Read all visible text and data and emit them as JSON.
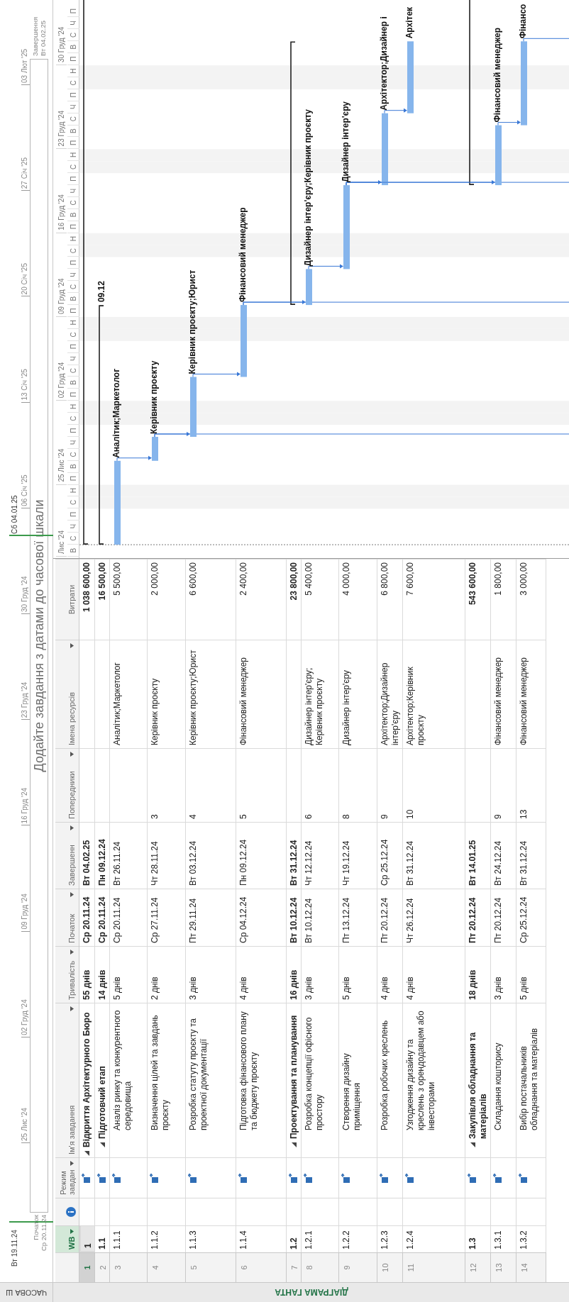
{
  "side_labels": {
    "timeline": "ЧАСОВА Ш",
    "gantt": "ДІАГРАМА ГАНТА"
  },
  "timeline": {
    "range_start": "Вт 19.11.24",
    "current_date": "Сб 04.01.25",
    "start_label": "Початок",
    "start_date": "Ср 20.11.24",
    "finish_label": "Завершення",
    "finish_date": "Вт 04.02.25",
    "hint": "Додайте завдання з датами до часової шкали",
    "ticks": [
      "25 Лис '24",
      "02 Груд '24",
      "09 Груд '24",
      "16 Груд '24",
      "23 Груд '24",
      "30 Груд '24",
      "06 Січ '25",
      "13 Січ '25",
      "20 Січ '25",
      "27 Січ '25",
      "03 Лют '25"
    ]
  },
  "table": {
    "columns": [
      {
        "kind": "text",
        "label": "WB",
        "dropdown": true,
        "selected": true
      },
      {
        "kind": "info",
        "selected": false
      },
      {
        "kind": "text",
        "label": "Режим завдан",
        "dropdown": true,
        "selected": false
      },
      {
        "kind": "text",
        "label": "Ім'я завдання",
        "dropdown": true,
        "selected": false
      },
      {
        "kind": "text",
        "label": "Тривалість",
        "dropdown": true,
        "selected": false
      },
      {
        "kind": "text",
        "label": "Початок",
        "dropdown": true,
        "selected": false
      },
      {
        "kind": "text",
        "label": "Завершенн",
        "dropdown": true,
        "selected": false
      },
      {
        "kind": "text",
        "label": "Попередники",
        "dropdown": true,
        "selected": false
      },
      {
        "kind": "text",
        "label": "Імена ресурсів",
        "dropdown": true,
        "selected": false
      },
      {
        "kind": "text",
        "label": "Витрати",
        "dropdown": false,
        "selected": false
      }
    ],
    "rows": [
      {
        "row": "1",
        "wbs": "1",
        "name": "Відкриття Архітектурного Бюро",
        "duration": "55 днів",
        "start": "Ср 20.11.24",
        "finish": "Вт 04.02.25",
        "cost": "1 038 600,00",
        "selected": true,
        "expanded": true,
        "children": [
          {
            "row": "2",
            "wbs": "1.1",
            "name": "Підготовчий етап",
            "duration": "14 днів",
            "start": "Ср 20.11.24",
            "finish": "Пн 09.12.24",
            "cost": "16 500,00",
            "selected": false,
            "expanded": true,
            "bar_label": "09.12",
            "children": [
              {
                "row": "3",
                "wbs": "1.1.1",
                "name": "Аналіз ринку та конкурентного середовища",
                "duration": "5 днів",
                "start": "Ср 20.11.24",
                "finish": "Вт 26.11.24",
                "resources": "Аналітик;Маркетолог",
                "cost": "5 500,00",
                "selected": false,
                "bar_label": "Аналітик;Маркетолог"
              },
              {
                "row": "4",
                "wbs": "1.1.2",
                "name": "Визначення цілей та завдань проєкту",
                "duration": "2 днів",
                "start": "Ср 27.11.24",
                "finish": "Чт 28.11.24",
                "predecessors": "3",
                "resources": "Керівник проєкту",
                "cost": "2 000,00",
                "selected": false,
                "bar_label": "Керівник проєкту",
                "link_below": true
              },
              {
                "row": "5",
                "wbs": "1.1.3",
                "name": "Розробка статуту проєкту та проектної документації",
                "duration": "3 днів",
                "start": "Пт 29.11.24",
                "finish": "Вт 03.12.24",
                "predecessors": "4",
                "resources": "Керівник проєкту;Юрист",
                "cost": "6 600,00",
                "selected": false,
                "bar_label": "Керівник проєкту;Юрист"
              },
              {
                "row": "6",
                "wbs": "1.1.4",
                "name": "Підготовка фінансового плану та бюджету проєкту",
                "duration": "4 днів",
                "start": "Ср 04.12.24",
                "finish": "Пн 09.12.24",
                "predecessors": "5",
                "resources": "Фінансовий менеджер",
                "cost": "2 400,00",
                "selected": false,
                "bar_label": "Фінансовий менеджер",
                "link_below": true
              }
            ]
          },
          {
            "row": "7",
            "wbs": "1.2",
            "name": "Проектування та планування",
            "duration": "16 днів",
            "start": "Вт 10.12.24",
            "finish": "Вт 31.12.24",
            "cost": "23 800,00",
            "selected": false,
            "expanded": true,
            "children": [
              {
                "row": "8",
                "wbs": "1.2.1",
                "name": "Розробка концепції офісного простору",
                "duration": "3 днів",
                "start": "Вт 10.12.24",
                "finish": "Чт 12.12.24",
                "predecessors": "6",
                "resources": "Дизайнер інтер'єру;Керівник проєкту",
                "cost": "5 400,00",
                "selected": false,
                "bar_label": "Дизайнер інтер'єру;Керівник проєкту"
              },
              {
                "row": "9",
                "wbs": "1.2.2",
                "name": "Створення дизайну приміщення",
                "duration": "5 днів",
                "start": "Пт 13.12.24",
                "finish": "Чт 19.12.24",
                "predecessors": "8",
                "resources": "Дизайнер інтер'єру",
                "cost": "4 000,00",
                "selected": false,
                "bar_label": "Дизайнер інтер'єру",
                "link_below": true
              },
              {
                "row": "10",
                "wbs": "1.2.3",
                "name": "Розробка робочих креслень",
                "duration": "4 днів",
                "start": "Пт 20.12.24",
                "finish": "Ср 25.12.24",
                "predecessors": "9",
                "resources": "Архітектор;Дизайнер інтер'єру",
                "cost": "6 800,00",
                "selected": false,
                "bar_label": "Архітектор;Дизайнер і"
              },
              {
                "row": "11",
                "wbs": "1.2.4",
                "name": "Узгодження дизайну та креслень з орендодавцем або інвесторами",
                "duration": "4 днів",
                "start": "Чт 26.12.24",
                "finish": "Вт 31.12.24",
                "predecessors": "10",
                "resources": "Архітектор;Керівник проєкту",
                "cost": "7 600,00",
                "selected": false,
                "bar_label": "Архітек"
              }
            ]
          },
          {
            "row": "12",
            "wbs": "1.3",
            "name": "Закупівля обладнання та матеріалів",
            "duration": "18 днів",
            "start": "Пт 20.12.24",
            "finish": "Вт 14.01.25",
            "cost": "543 600,00",
            "selected": false,
            "expanded": true,
            "children": [
              {
                "row": "13",
                "wbs": "1.3.1",
                "name": "Складання кошторису",
                "duration": "3 днів",
                "start": "Пт 20.12.24",
                "finish": "Вт 24.12.24",
                "predecessors": "9",
                "resources": "Фінансовий менеджер",
                "cost": "1 800,00",
                "selected": false,
                "bar_label": "Фінансовий менеджер"
              },
              {
                "row": "14",
                "wbs": "1.3.2",
                "name": "Вибір постачальників обладнання та матеріалів",
                "duration": "5 днів",
                "start": "Ср 25.12.24",
                "finish": "Вт 31.12.24",
                "predecessors": "13",
                "resources": "Фінансовий менеджер",
                "cost": "3 000,00",
                "selected": false,
                "bar_label": "Фінансо",
                "link_below": true
              }
            ]
          }
        ]
      }
    ]
  },
  "gantt": {
    "weeks": [
      "Лис '24",
      "25 Лис '24",
      "02 Груд '24",
      "09 Груд '24",
      "16 Груд '24",
      "23 Груд '24",
      "30 Груд '24"
    ],
    "days": [
      {
        "label": "В",
        "weekend": false
      },
      {
        "label": "С",
        "weekend": false
      },
      {
        "label": "Ч",
        "weekend": false
      },
      {
        "label": "П",
        "weekend": false
      },
      {
        "label": "С",
        "weekend": true
      },
      {
        "label": "Н",
        "weekend": true
      },
      {
        "label": "П",
        "weekend": false
      },
      {
        "label": "В",
        "weekend": false
      },
      {
        "label": "С",
        "weekend": false
      },
      {
        "label": "Ч",
        "weekend": false
      },
      {
        "label": "П",
        "weekend": false
      },
      {
        "label": "С",
        "weekend": true
      },
      {
        "label": "Н",
        "weekend": true
      },
      {
        "label": "П",
        "weekend": false
      },
      {
        "label": "В",
        "weekend": false
      },
      {
        "label": "С",
        "weekend": false
      },
      {
        "label": "Ч",
        "weekend": false
      },
      {
        "label": "П",
        "weekend": false
      },
      {
        "label": "С",
        "weekend": true
      },
      {
        "label": "Н",
        "weekend": true
      },
      {
        "label": "П",
        "weekend": false
      },
      {
        "label": "В",
        "weekend": false
      },
      {
        "label": "С",
        "weekend": false
      },
      {
        "label": "Ч",
        "weekend": false
      },
      {
        "label": "П",
        "weekend": false
      },
      {
        "label": "С",
        "weekend": true
      },
      {
        "label": "Н",
        "weekend": true
      },
      {
        "label": "П",
        "weekend": false
      },
      {
        "label": "В",
        "weekend": false
      },
      {
        "label": "С",
        "weekend": false
      },
      {
        "label": "Ч",
        "weekend": false
      },
      {
        "label": "П",
        "weekend": false
      },
      {
        "label": "С",
        "weekend": true
      },
      {
        "label": "Н",
        "weekend": true
      },
      {
        "label": "П",
        "weekend": false
      },
      {
        "label": "В",
        "weekend": false
      },
      {
        "label": "С",
        "weekend": false
      },
      {
        "label": "Ч",
        "weekend": false
      },
      {
        "label": "П",
        "weekend": false
      },
      {
        "label": "С",
        "weekend": true
      },
      {
        "label": "Н",
        "weekend": true
      },
      {
        "label": "П",
        "weekend": false
      },
      {
        "label": "В",
        "weekend": false
      },
      {
        "label": "С",
        "weekend": false
      },
      {
        "label": "Ч",
        "weekend": false
      },
      {
        "label": "П",
        "weekend": false
      }
    ]
  }
}
